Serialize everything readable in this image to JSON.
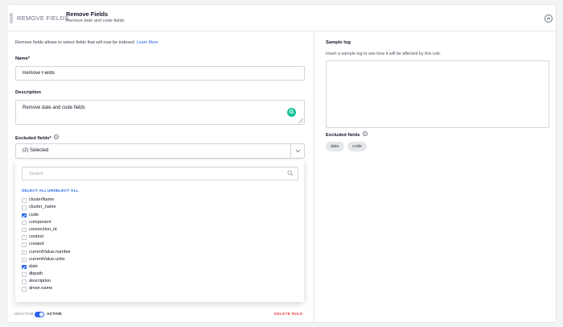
{
  "header": {
    "rule_type": "REMOVE FIELDS",
    "title": "Remove Fields",
    "subtitle": "Remove date and code fields"
  },
  "intro": {
    "text": "Remove fields allows to select fields that will now be indexed",
    "link": "Learn More"
  },
  "name_field": {
    "label": "Name*",
    "value": "Remove Fields"
  },
  "description_field": {
    "label": "Description",
    "value": "Remove date and code fields"
  },
  "excluded_fields": {
    "label": "Excluded fields*",
    "selected_text": "(2) Selected",
    "search_placeholder": "Search",
    "select_all": "SELECT ALL",
    "unselect_all": "UNSELECT ALL",
    "items": [
      {
        "label": "clusterName",
        "checked": false
      },
      {
        "label": "cluster_name",
        "checked": false
      },
      {
        "label": "code",
        "checked": true
      },
      {
        "label": "component",
        "checked": false
      },
      {
        "label": "connection_id",
        "checked": false
      },
      {
        "label": "context",
        "checked": false
      },
      {
        "label": "created",
        "checked": false
      },
      {
        "label": "currentValue.number",
        "checked": false
      },
      {
        "label": "currentValue.units",
        "checked": false
      },
      {
        "label": "date",
        "checked": true
      },
      {
        "label": "dbpath",
        "checked": false
      },
      {
        "label": "description",
        "checked": false
      },
      {
        "label": "driver.name",
        "checked": false
      }
    ]
  },
  "footer": {
    "inactive_label": "INACTIVE",
    "active_label": "ACTIVE",
    "active": true,
    "delete_label": "DELETE RULE"
  },
  "sample_log": {
    "title": "Sample log",
    "description": "Insert a sample log to see how it will be affected by this rule.",
    "value": "",
    "excluded_label": "Excluded fields",
    "excluded_chips": [
      "date",
      "code"
    ]
  },
  "colors": {
    "accent": "#2563eb",
    "danger": "#ef4444",
    "grammarly": "#15c39a"
  },
  "icons": {
    "collapse": "chevron-up-icon",
    "help": "help-circle-icon",
    "search": "search-icon",
    "dropdown": "chevron-down-icon"
  }
}
